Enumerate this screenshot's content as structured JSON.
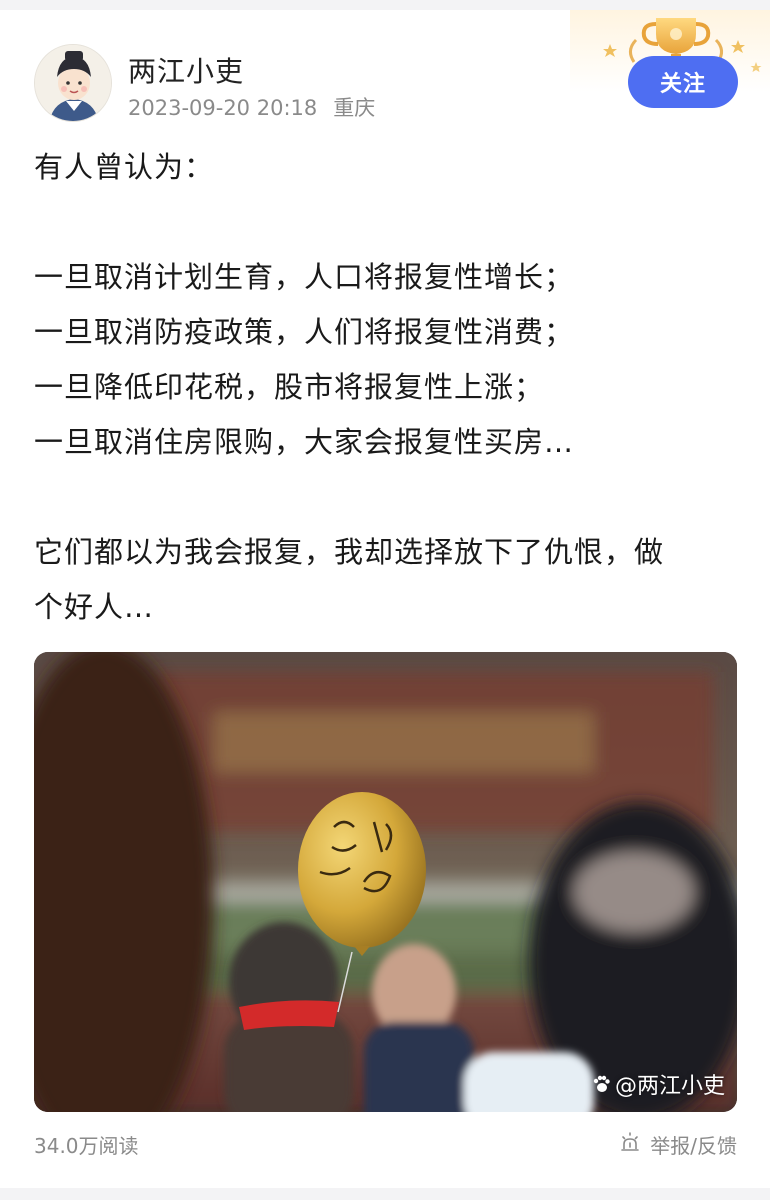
{
  "author": {
    "name": "两江小吏",
    "date": "2023-09-20 20:18",
    "location": "重庆",
    "avatar_icon": "cartoon-official-avatar"
  },
  "follow_button": {
    "label": "关注",
    "color": "#4e6ef2"
  },
  "badge_icon": "gold-trophy-icon",
  "post_lines": [
    "有人曾认为：",
    "",
    "一旦取消计划生育，人口将报复性增长；",
    "一旦取消防疫政策，人们将报复性消费；",
    "一旦降低印花税，股市将报复性上涨；",
    "一旦取消住房限购，大家会报复性买房…",
    "",
    "它们都以为我会报复，我却选择放下了仇恨，做",
    "个好人…"
  ],
  "photo": {
    "description_icon": "yellow-balloon-photo",
    "watermark": "@两江小吏",
    "watermark_icon": "paw-icon"
  },
  "footer": {
    "reads": "34.0万阅读",
    "report_label": "举报/反馈",
    "report_icon": "report-icon"
  }
}
